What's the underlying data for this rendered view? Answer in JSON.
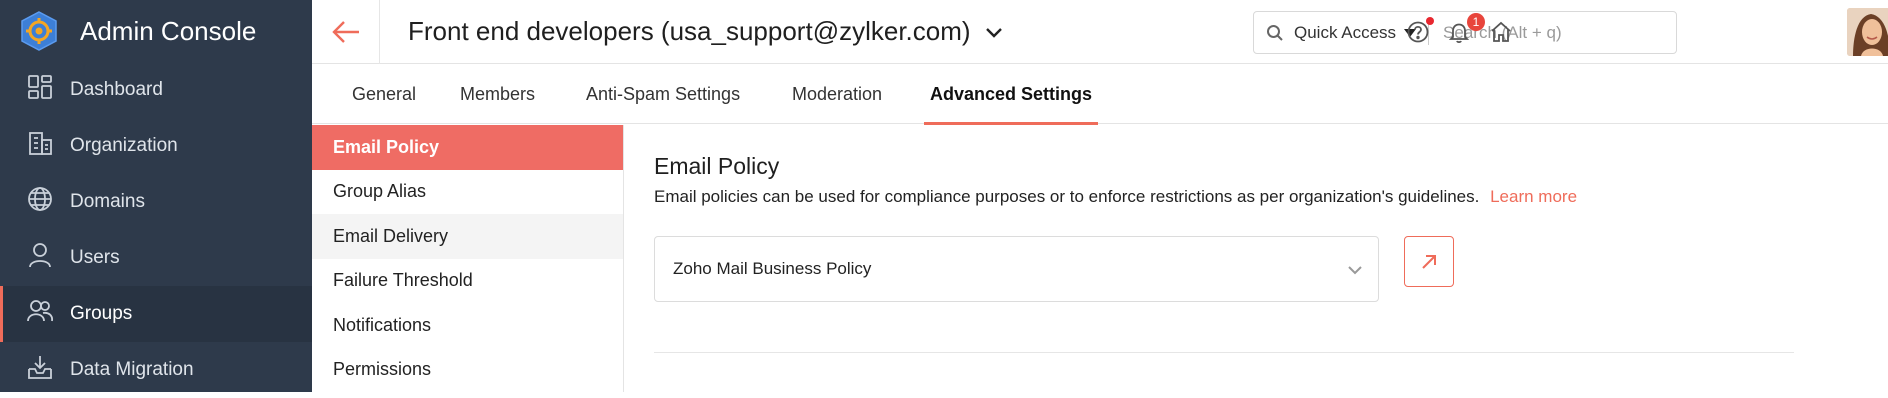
{
  "app": {
    "title": "Admin Console"
  },
  "sidebar": {
    "items": [
      {
        "label": "Dashboard",
        "icon": "dashboard-icon"
      },
      {
        "label": "Organization",
        "icon": "organization-icon"
      },
      {
        "label": "Domains",
        "icon": "globe-icon"
      },
      {
        "label": "Users",
        "icon": "user-icon"
      },
      {
        "label": "Groups",
        "icon": "groups-icon",
        "active": true
      },
      {
        "label": "Data Migration",
        "icon": "inbox-download-icon"
      }
    ]
  },
  "header": {
    "title": "Front end developers (usa_support@zylker.com)",
    "quick_access_label": "Quick Access",
    "search_placeholder": "Search (Alt + q)",
    "notification_count": "1"
  },
  "tabs": [
    {
      "label": "General"
    },
    {
      "label": "Members"
    },
    {
      "label": "Anti-Spam Settings"
    },
    {
      "label": "Moderation"
    },
    {
      "label": "Advanced Settings",
      "active": true
    }
  ],
  "submenu": [
    {
      "label": "Email Policy",
      "active": true
    },
    {
      "label": "Group Alias"
    },
    {
      "label": "Email Delivery"
    },
    {
      "label": "Failure Threshold"
    },
    {
      "label": "Notifications"
    },
    {
      "label": "Permissions"
    }
  ],
  "content": {
    "title": "Email Policy",
    "description": "Email policies can be used for compliance purposes or to enforce restrictions as per organization's guidelines.",
    "learn_more": "Learn more",
    "policy_value": "Zoho Mail Business Policy"
  },
  "colors": {
    "accent": "#ef6c5a",
    "sidebar": "#2e3a4b"
  }
}
